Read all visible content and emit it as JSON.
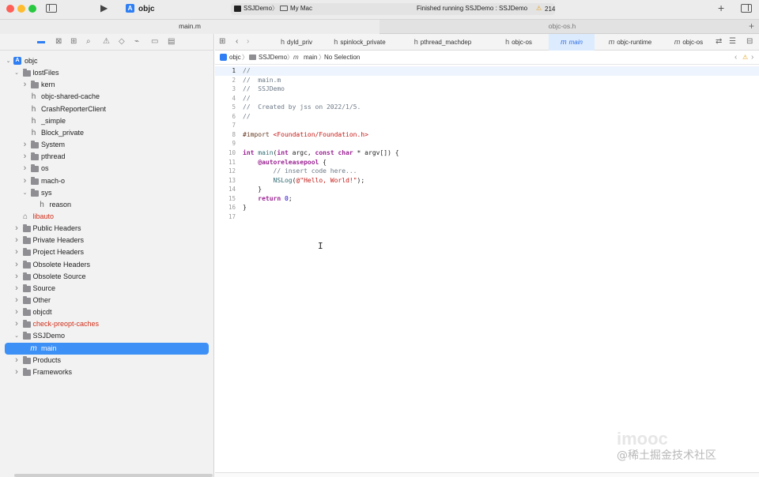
{
  "toolbar": {
    "scheme": "objc",
    "target_scheme": "SSJDemo",
    "destination": "My Mac",
    "status": "Finished running SSJDemo : SSJDemo",
    "warnings": "214",
    "warning_icon": "warning-icon"
  },
  "file_tabs": [
    "main.m",
    "objc-os.h"
  ],
  "navigator": {
    "items": [
      {
        "label": "objc",
        "depth": 0,
        "type": "project",
        "open": true
      },
      {
        "label": "lostFiles",
        "depth": 1,
        "type": "folder",
        "open": true
      },
      {
        "label": "kern",
        "depth": 2,
        "type": "folder",
        "open": false
      },
      {
        "label": "objc-shared-cache",
        "depth": 2,
        "type": "header"
      },
      {
        "label": "CrashReporterClient",
        "depth": 2,
        "type": "header"
      },
      {
        "label": "_simple",
        "depth": 2,
        "type": "header"
      },
      {
        "label": "Block_private",
        "depth": 2,
        "type": "header"
      },
      {
        "label": "System",
        "depth": 2,
        "type": "folder",
        "open": false
      },
      {
        "label": "pthread",
        "depth": 2,
        "type": "folder",
        "open": false
      },
      {
        "label": "os",
        "depth": 2,
        "type": "folder",
        "open": false
      },
      {
        "label": "mach-o",
        "depth": 2,
        "type": "folder",
        "open": false
      },
      {
        "label": "sys",
        "depth": 2,
        "type": "folder",
        "open": true
      },
      {
        "label": "reason",
        "depth": 3,
        "type": "header"
      },
      {
        "label": "libauto",
        "depth": 1,
        "type": "library",
        "red": true
      },
      {
        "label": "Public Headers",
        "depth": 1,
        "type": "folder",
        "open": false
      },
      {
        "label": "Private Headers",
        "depth": 1,
        "type": "folder",
        "open": false
      },
      {
        "label": "Project Headers",
        "depth": 1,
        "type": "folder",
        "open": false
      },
      {
        "label": "Obsolete Headers",
        "depth": 1,
        "type": "folder",
        "open": false
      },
      {
        "label": "Obsolete Source",
        "depth": 1,
        "type": "folder",
        "open": false
      },
      {
        "label": "Source",
        "depth": 1,
        "type": "folder",
        "open": false
      },
      {
        "label": "Other",
        "depth": 1,
        "type": "folder",
        "open": false
      },
      {
        "label": "objcdt",
        "depth": 1,
        "type": "folder",
        "open": false
      },
      {
        "label": "check-preopt-caches",
        "depth": 1,
        "type": "folder",
        "open": false,
        "red": true
      },
      {
        "label": "SSJDemo",
        "depth": 1,
        "type": "folder",
        "open": true
      },
      {
        "label": "main",
        "depth": 2,
        "type": "source",
        "selected": true
      },
      {
        "label": "Products",
        "depth": 1,
        "type": "folder",
        "open": false
      },
      {
        "label": "Frameworks",
        "depth": 1,
        "type": "folder",
        "open": false
      }
    ]
  },
  "editor_tabs": [
    {
      "label": "dyld_priv",
      "icon": "h"
    },
    {
      "label": "spinlock_private",
      "icon": "h"
    },
    {
      "label": "pthread_machdep",
      "icon": "h"
    },
    {
      "label": "objc-os",
      "icon": "h"
    },
    {
      "label": "main",
      "icon": "m",
      "active": true
    },
    {
      "label": "objc-runtime",
      "icon": "m"
    },
    {
      "label": "objc-os",
      "icon": "m"
    }
  ],
  "jump_bar": [
    "objc",
    "SSJDemo",
    "main",
    "No Selection"
  ],
  "code_lines": [
    "//",
    "//  main.m",
    "//  SSJDemo",
    "//",
    "//  Created by jss on 2022/1/5.",
    "//",
    "",
    "#import <Foundation/Foundation.h>",
    "",
    "int main(int argc, const char * argv[]) {",
    "    @autoreleasepool {",
    "        // insert code here...",
    "        NSLog(@\"Hello, World!\");",
    "    }",
    "    return 0;",
    "}",
    ""
  ],
  "watermark": "@稀土掘金技术社区",
  "colors": {
    "accent": "#3d90f6",
    "comment": "#6c7986",
    "keyword": "#9b2393",
    "string": "#c41a16",
    "error_red": "#d12f1b"
  }
}
